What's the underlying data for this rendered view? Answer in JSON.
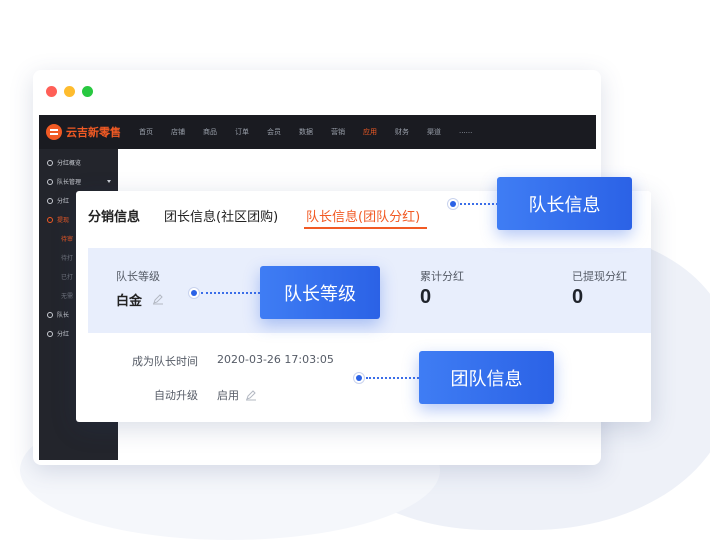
{
  "app": {
    "brand": "云吉新零售",
    "nav": [
      "首页",
      "店铺",
      "商品",
      "订单",
      "会员",
      "数据",
      "营销",
      "应用",
      "财务",
      "渠道",
      "......"
    ],
    "nav_active": "应用",
    "sidebar": [
      {
        "label": "分红概览"
      },
      {
        "label": "队长管理"
      },
      {
        "label": "分红"
      },
      {
        "label": "提现"
      },
      {
        "label": "队长"
      },
      {
        "label": "分红"
      }
    ],
    "sidebar_sub": [
      "待审",
      "待打",
      "已打",
      "无需"
    ]
  },
  "tabs": [
    {
      "label": "分销信息"
    },
    {
      "label": "团长信息(社区团购)"
    },
    {
      "label": "队长信息(团队分红)"
    }
  ],
  "panel": {
    "level_label": "队长等级",
    "level_value": "白金",
    "total_label": "累计分红",
    "total_value": "0",
    "withdrawn_label": "已提现分红",
    "withdrawn_value": "0"
  },
  "info": {
    "time_label": "成为队长时间",
    "time_value": "2020-03-26 17:03:05",
    "upgrade_label": "自动升级",
    "upgrade_value": "启用"
  },
  "callouts": {
    "captain_info": "队长信息",
    "captain_level": "队长等级",
    "team_info": "团队信息"
  },
  "colors": {
    "accent": "#f15a24",
    "callout_blue": "#2b62e6",
    "panel_bg": "#e8eefc"
  }
}
